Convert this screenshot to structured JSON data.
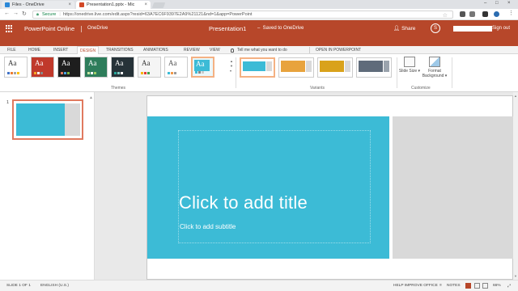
{
  "browser": {
    "tabs": [
      {
        "title": "Files - OneDrive",
        "favicon_color": "#2b88d8"
      },
      {
        "title": "Presentation1.pptx - Mic",
        "favicon_color": "#d24726"
      }
    ],
    "address": {
      "secure_label": "Secure",
      "url": "https://onedrive.live.com/edit.aspx?resid=63A7EC6F9397E2A9%21121&nd=1&app=PowerPoint"
    }
  },
  "app": {
    "name": "PowerPoint Online",
    "location": "OneDrive",
    "document": "Presentation1",
    "status": "Saved to OneDrive",
    "share_label": "Share",
    "signout_label": "Sign out",
    "accent_color": "#b7472a"
  },
  "ribbon": {
    "tabs": [
      "FILE",
      "HOME",
      "INSERT",
      "DESIGN",
      "TRANSITIONS",
      "ANIMATIONS",
      "REVIEW",
      "VIEW"
    ],
    "active_tab": "DESIGN",
    "tell_me": "Tell me what you want to do",
    "open_in_app": "OPEN IN POWERPOINT",
    "themes_label": "Themes",
    "variants_label": "Variants",
    "customize_label": "Customize",
    "theme_sample": "Aa",
    "slide_size": "Slide Size",
    "format_background": "Format Background"
  },
  "slide_pane": {
    "slide_number": "1"
  },
  "slide": {
    "title_placeholder": "Click to add title",
    "subtitle_placeholder": "Click to add subtitle",
    "theme_color": "#3cbbd6"
  },
  "status_bar": {
    "slide_info": "SLIDE 1 OF 1",
    "language": "ENGLISH (U.S.)",
    "help": "HELP IMPROVE OFFICE",
    "notes": "NOTES",
    "zoom": "66%"
  }
}
